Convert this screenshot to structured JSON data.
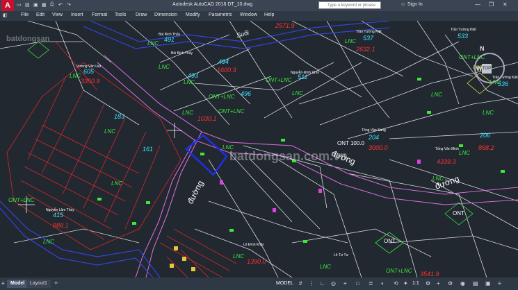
{
  "app": {
    "logo": "A",
    "title": "Autodesk AutoCAD 2018   DT_10.dwg",
    "search_placeholder": "Type a keyword or phrase",
    "signin": "Sign In"
  },
  "menu": [
    "File",
    "Edit",
    "View",
    "Insert",
    "Format",
    "Tools",
    "Draw",
    "Dimension",
    "Modify",
    "Parametric",
    "Window",
    "Help"
  ],
  "viewcube": {
    "north": "N",
    "west": "W",
    "top": "TOP"
  },
  "watermarks": {
    "center": "batdongsan.com.vn",
    "topleft": "batdongsan"
  },
  "labels": {
    "road1": "đường",
    "road2": "đường",
    "road3": "đường",
    "suoi": "Suối",
    "ont1": "ONT",
    "ont2": "ONT",
    "ont3": "ONT",
    "ont_lnc1": "ONT+LNC",
    "ont_lnc2": "ONT+LNC",
    "ont_lnc3": "ONT+LNC",
    "ont_lnc4": "ONT+LNC",
    "ont_lnc5": "ONT+LNC",
    "ont_lnc6": "ONT+LNC",
    "ont_100": "ONT 100.0",
    "lnc1": "LNC",
    "lnc2": "LNC",
    "lnc3": "LNC",
    "lnc4": "LNC",
    "lnc5": "LNC",
    "lnc6": "LNC",
    "lnc7": "LNC",
    "lnc8": "LNC",
    "lnc9": "LNC",
    "lnc10": "LNC",
    "lnc11": "LNC",
    "lnc12": "LNC",
    "lnc13": "LNC",
    "lnc14": "LNC",
    "lnc15": "LNC",
    "lnc16": "LNC",
    "lnc17": "LNC",
    "lnc18": "LNC",
    "owner_bui_bich_thuy1": "Bùi Bích Thủy",
    "owner_bui_bich_thuy2": "Bùi Bích Thủy",
    "owner_vuong_van_liet": "Vương Văn Liệt",
    "owner_tran_tuong_kiet1": "Trần Tường Kiệt",
    "owner_tran_tuong_kiet2": "Trần Tường Kiệt",
    "owner_tran_tuong_kiet3": "Trần Tường Kiệt",
    "owner_nguyen_dinh_chin": "Nguyễn Đình Chín",
    "owner_tong_van_sang": "Tống Văn Sang",
    "owner_tong_van_minh": "Tống Văn Minh",
    "owner_nguyen_lam_thuy": "Nguyễn Lâm Thủy",
    "owner_le_tu_tu": "Lê Tư Tư",
    "owner_le_dinh_khai": "Lê Đình Khải",
    "num_491": "491",
    "num_493": "493",
    "num_494": "494",
    "num_496": "496",
    "num_605": "605",
    "num_537": "537",
    "num_533": "533",
    "num_536": "536",
    "num_511": "511",
    "num_204": "204",
    "num_206": "206",
    "num_415": "415",
    "num_183": "183",
    "num_161": "161",
    "area_1": "3350.9",
    "area_2": "2632.1",
    "area_3": "1600.3",
    "area_4": "1030.1",
    "area_5": "3000.0",
    "area_6": "868.2",
    "area_7": "4339.3",
    "area_8": "888.1",
    "area_9": "3541.9",
    "area_10": "1390.0",
    "area_11": "2571.9"
  },
  "status": {
    "tab_model": "Model",
    "tab_layout": "Layout1",
    "tab_add": "+",
    "model": "MODEL",
    "scale": "1:1"
  },
  "colors": {
    "background": "#212830",
    "parcel_lines": "#d8d8e0",
    "red_parcels": "#d9262e",
    "road": "#d46bd6",
    "stream": "#3344dd",
    "lnc_green": "#3ce83c",
    "area_red": "#ff3232",
    "number_cyan": "#3ce6ff"
  }
}
